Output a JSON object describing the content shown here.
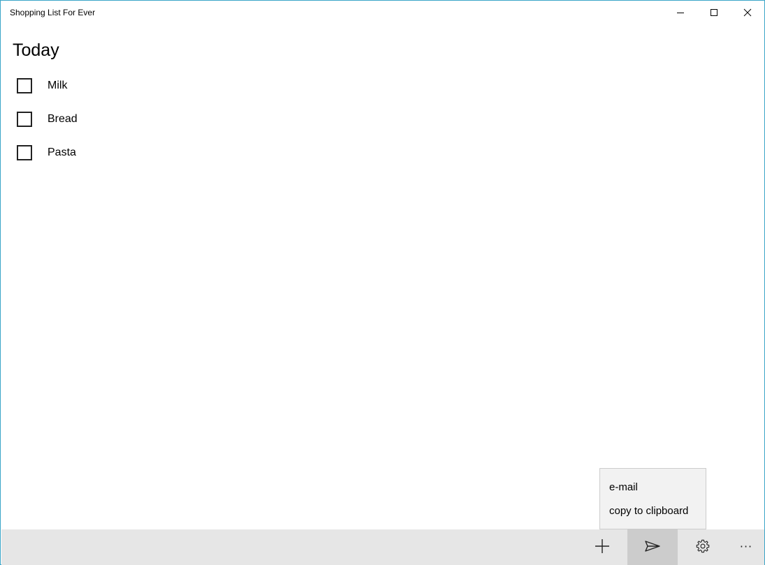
{
  "window": {
    "title": "Shopping List For Ever",
    "accent_border": "#3aa5c8"
  },
  "controls": {
    "minimize_icon": "minimize-icon",
    "maximize_icon": "maximize-icon",
    "close_icon": "close-icon"
  },
  "main": {
    "section_title": "Today",
    "items": [
      {
        "label": "Milk",
        "checked": false
      },
      {
        "label": "Bread",
        "checked": false
      },
      {
        "label": "Pasta",
        "checked": false
      }
    ]
  },
  "share_menu": {
    "items": [
      {
        "label": "e-mail"
      },
      {
        "label": "copy to clipboard"
      }
    ]
  },
  "commandbar": {
    "buttons": [
      {
        "icon": "add-icon"
      },
      {
        "icon": "send-icon",
        "active": true
      },
      {
        "icon": "gear-icon"
      },
      {
        "icon": "more-icon",
        "label": "···"
      }
    ],
    "background": "#e6e6e6",
    "active_background": "#cccccc"
  }
}
